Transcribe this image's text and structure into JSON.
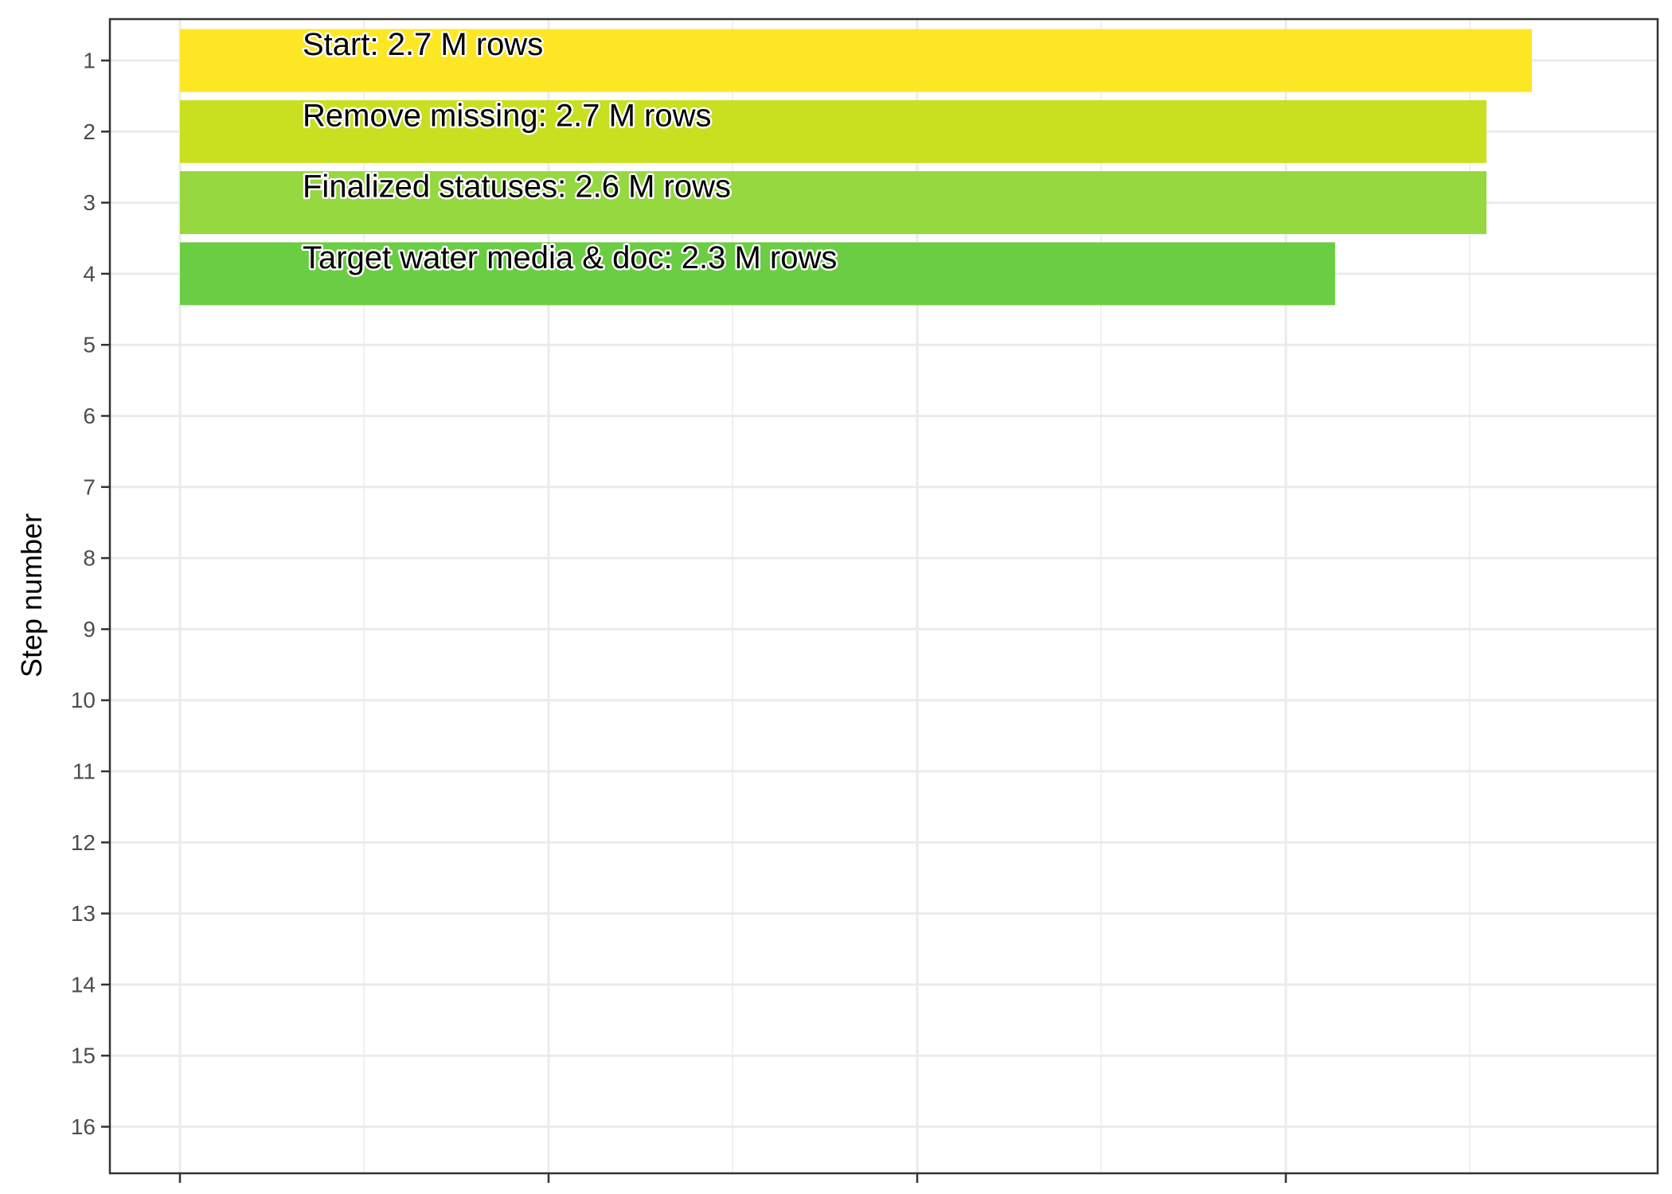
{
  "chart_data": {
    "type": "bar",
    "orientation": "horizontal",
    "ylabel": "Step number",
    "xlabel": "",
    "y_categories": [
      "1",
      "2",
      "3",
      "4",
      "5",
      "6",
      "7",
      "8",
      "9",
      "10",
      "11",
      "12",
      "13",
      "14",
      "15",
      "16"
    ],
    "xlim": [
      0,
      2.8
    ],
    "grid": true,
    "bars": [
      {
        "step": 1,
        "value": 2.68,
        "label": "Start:  2.7 M rows",
        "color": "#FDE725"
      },
      {
        "step": 2,
        "value": 2.59,
        "label": "Remove missing:  2.7 M rows",
        "color": "#C8E020"
      },
      {
        "step": 3,
        "value": 2.59,
        "label": "Finalized statuses:  2.6 M rows",
        "color": "#95D840"
      },
      {
        "step": 4,
        "value": 2.29,
        "label": "Target water media & doc:  2.3 M rows",
        "color": "#6ACD43"
      }
    ]
  }
}
